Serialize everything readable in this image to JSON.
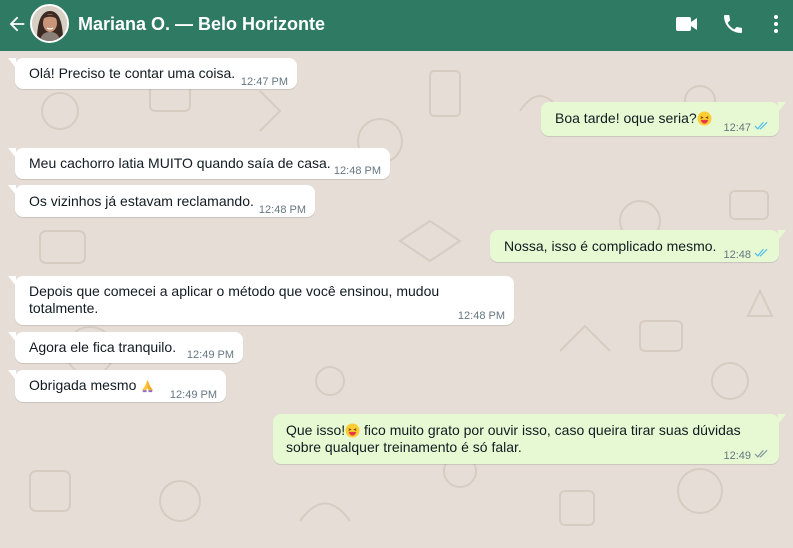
{
  "header": {
    "contact_name": "Mariana O. — Belo Horizonte",
    "icons": [
      "back-arrow-icon",
      "video-call-icon",
      "phone-icon",
      "menu-dots-icon"
    ],
    "bar_color": "#2f7a62"
  },
  "messages": [
    {
      "dir": "in",
      "text": "Olá! Preciso te contar uma coisa.",
      "time": "12:47 PM"
    },
    {
      "dir": "out",
      "text": "Boa tarde! oque seria?",
      "emoji": "grinning-squinting-face",
      "time": "12:47",
      "status": "read"
    },
    {
      "dir": "in",
      "text": "Meu cachorro latia MUITO quando saía de casa.",
      "time": "12:48 PM"
    },
    {
      "dir": "in",
      "text": "Os vizinhos já estavam reclamando.",
      "time": "12:48 PM"
    },
    {
      "dir": "out",
      "text": "Nossa, isso é complicado mesmo.",
      "time": "12:48",
      "status": "read"
    },
    {
      "dir": "in",
      "text": "Depois que comecei a aplicar o método que você ensinou, mudou totalmente.",
      "time": "12:48 PM"
    },
    {
      "dir": "in",
      "text": "Agora ele fica tranquilo.",
      "time": "12:49 PM"
    },
    {
      "dir": "in",
      "text": "Obrigada mesmo",
      "emoji": "folded-hands",
      "time": "12:49 PM"
    },
    {
      "dir": "out",
      "text_before": "Que isso!",
      "emoji": "grinning-squinting-face",
      "text_after": " fico muito grato por ouvir isso, caso queira tirar suas dúvidas sobre qualquer treinamento é só falar.",
      "time": "12:49",
      "status": "delivered"
    }
  ],
  "colors": {
    "incoming": "#ffffff",
    "outgoing": "#e7f9d3",
    "read_ticks": "#53bdeb",
    "delivered_ticks": "#8696a0"
  }
}
